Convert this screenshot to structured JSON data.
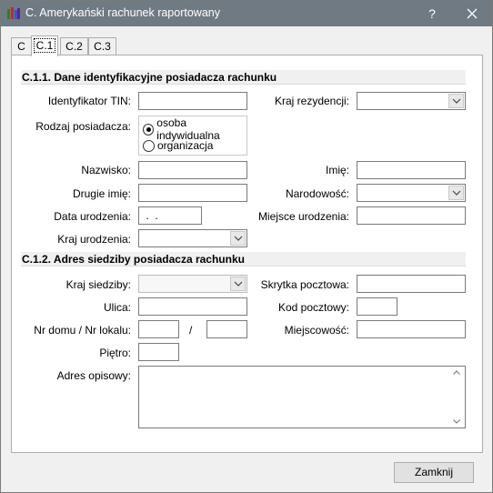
{
  "window": {
    "title": "C. Amerykański rachunek raportowany",
    "help_label": "?",
    "close_label": "✕"
  },
  "tabs": [
    {
      "label": "C"
    },
    {
      "label": "C.1"
    },
    {
      "label": "C.2"
    },
    {
      "label": "C.3"
    }
  ],
  "active_tab": "C.1",
  "section1": {
    "title": "C.1.1. Dane identyfikacyjne posiadacza rachunku",
    "tin_label": "Identyfikator TIN:",
    "tin_value": "",
    "kraj_rezydencji_label": "Kraj rezydencji:",
    "kraj_rezydencji_value": "",
    "rodzaj_label": "Rodzaj posiadacza:",
    "rodzaj_options": [
      "osoba indywidualna",
      "organizacja"
    ],
    "rodzaj_selected": "osoba indywidualna",
    "nazwisko_label": "Nazwisko:",
    "imie_label": "Imię:",
    "drugie_imie_label": "Drugie imię:",
    "narodowosc_label": "Narodowość:",
    "data_urodzenia_label": "Data urodzenia:",
    "data_urodzenia_value": " .  .",
    "miejsce_urodzenia_label": "Miejsce urodzenia:",
    "kraj_urodzenia_label": "Kraj urodzenia:"
  },
  "section2": {
    "title": "C.1.2. Adres siedziby posiadacza rachunku",
    "kraj_siedziby_label": "Kraj siedziby:",
    "skrytka_label": "Skrytka pocztowa:",
    "ulica_label": "Ulica:",
    "kod_label": "Kod pocztowy:",
    "nr_domu_label": "Nr domu / Nr lokalu:",
    "slash": "/",
    "miejscowosc_label": "Miejscowość:",
    "pietro_label": "Piętro:",
    "adres_opisowy_label": "Adres opisowy:"
  },
  "buttons": {
    "close_label": "Zamknij"
  },
  "icons": {
    "app": "app-icon",
    "dropdown": "chevron-down-icon",
    "scroll_up": "scroll-up-icon",
    "scroll_down": "scroll-down-icon"
  }
}
